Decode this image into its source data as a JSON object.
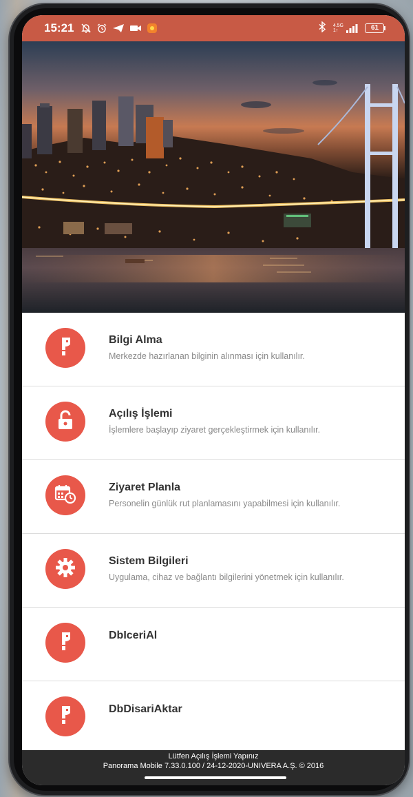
{
  "status_bar": {
    "time": "15:21",
    "network": "4.5G",
    "network_sub": "1↑",
    "battery": "61",
    "color": "#c85a45"
  },
  "menu": {
    "accent_color": "#e8584a",
    "items": [
      {
        "icon": "info-pen-icon",
        "title": "Bilgi Alma",
        "description": "Merkezde hazırlanan bilginin alınması için kullanılır."
      },
      {
        "icon": "unlock-icon",
        "title": "Açılış İşlemi",
        "description": "İşlemlere başlayıp ziyaret gerçekleştirmek için kullanılır."
      },
      {
        "icon": "calendar-clock-icon",
        "title": "Ziyaret Planla",
        "description": "Personelin günlük rut planlamasını yapabilmesi için kullanılır."
      },
      {
        "icon": "gear-icon",
        "title": "Sistem Bilgileri",
        "description": "Uygulama, cihaz ve bağlantı bilgilerini yönetmek için kullanılır."
      },
      {
        "icon": "info-pen-icon",
        "title": "DbIceriAl",
        "description": ""
      },
      {
        "icon": "info-pen-icon",
        "title": "DbDisariAktar",
        "description": ""
      }
    ]
  },
  "footer": {
    "line1": "Lütfen Açılış İşlemi Yapınız",
    "line2": "Panorama Mobile 7.33.0.100 / 24-12-2020-UNIVERA A.Ş. © 2016"
  }
}
